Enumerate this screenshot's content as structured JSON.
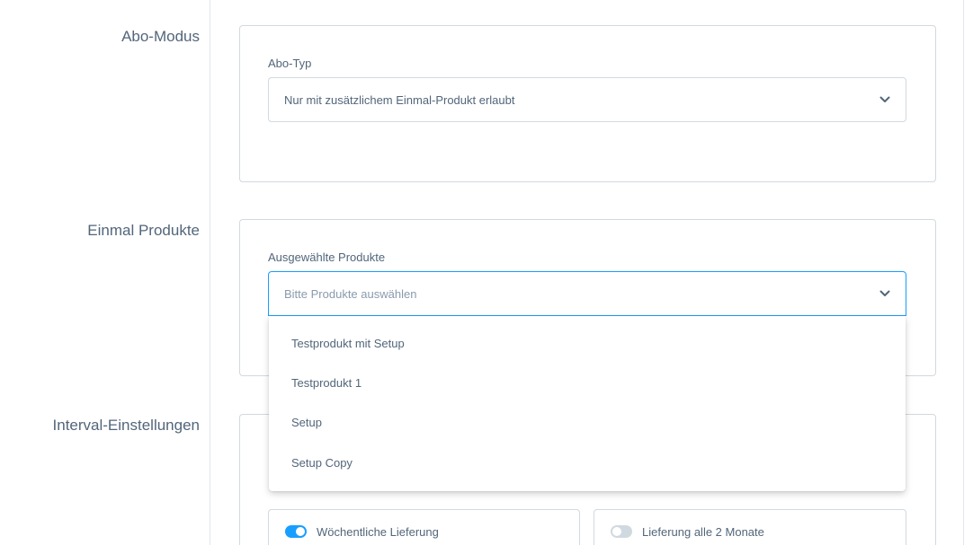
{
  "sections": {
    "abo_modus": {
      "label": "Abo-Modus",
      "field_label": "Abo-Typ",
      "select_value": "Nur mit zusätzlichem Einmal-Produkt erlaubt"
    },
    "einmal_produkte": {
      "label": "Einmal Produkte",
      "field_label": "Ausgewählte Produkte",
      "select_placeholder": "Bitte Produkte auswählen",
      "dropdown_options": [
        "Testprodukt mit Setup",
        "Testprodukt 1",
        "Setup",
        "Setup Copy"
      ]
    },
    "interval": {
      "label": "Interval-Einstellungen",
      "checkboxes": [
        {
          "label": "Wöchentliche Lieferung",
          "enabled": true
        },
        {
          "label": "Lieferung alle 2 Monate",
          "enabled": false
        }
      ]
    }
  },
  "icons": {
    "select_chevron": "chevron-down-icon"
  },
  "colors": {
    "accent": "#189eff",
    "text": "#52667a",
    "border": "#d1d9e0",
    "toggle_off": "#d1d9e0"
  }
}
